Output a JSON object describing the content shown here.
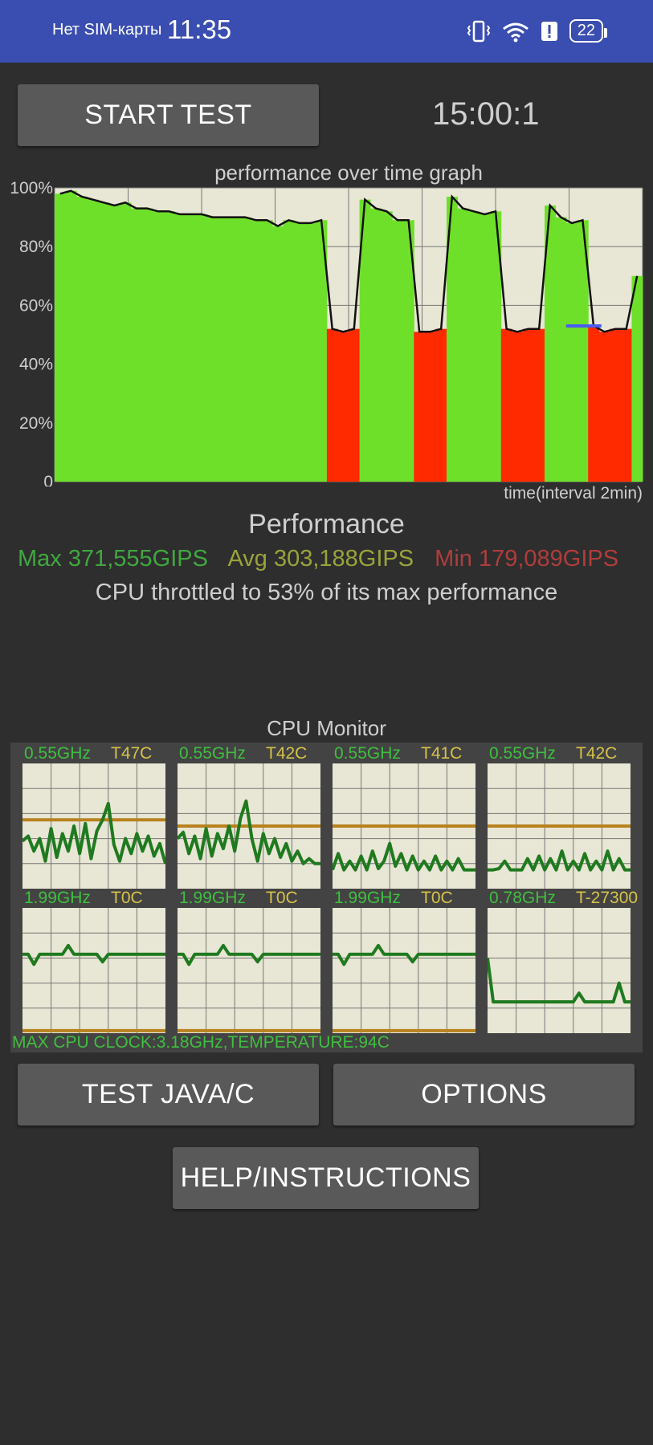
{
  "status_bar": {
    "carrier": "Нет SIM-карты",
    "time": "11:35",
    "battery": "22",
    "icons": [
      "vibrate-icon",
      "wifi-icon",
      "alert-icon",
      "battery-icon"
    ]
  },
  "buttons": {
    "start_test": "START TEST",
    "test_java_c": "TEST JAVA/C",
    "options": "OPTIONS",
    "help": "HELP/INSTRUCTIONS"
  },
  "timer": "15:00:1",
  "chart_data": {
    "type": "area",
    "title": "performance over time graph",
    "xlabel": "time(interval 2min)",
    "ylabel": "",
    "ylim": [
      0,
      100
    ],
    "y_ticks": [
      "0",
      "20%",
      "40%",
      "60%",
      "80%",
      "100%"
    ],
    "x": [
      0,
      0.5,
      1,
      1.5,
      2,
      2.5,
      3,
      3.5,
      4,
      4.5,
      5,
      5.5,
      6,
      6.5,
      7,
      7.5,
      8,
      8.5,
      9,
      9.5,
      10,
      10.5,
      11,
      11.5,
      12,
      12.5,
      13,
      13.5,
      14,
      14.5,
      15,
      15.5,
      16,
      16.5,
      17,
      17.5,
      18,
      18.5,
      19,
      19.5,
      20,
      20.5,
      21,
      21.5,
      22,
      22.5,
      23,
      23.5,
      24,
      24.5,
      25,
      25.5,
      26,
      26.5,
      27,
      27.5,
      28,
      28.5,
      29,
      29.5,
      30
    ],
    "series": [
      {
        "values": [
          98,
          99,
          97,
          96,
          95,
          94,
          95,
          93,
          93,
          92,
          92,
          91,
          91,
          91,
          90,
          90,
          90,
          90,
          89,
          89,
          87,
          89,
          88,
          88,
          89,
          52,
          51,
          52,
          96,
          93,
          92,
          89,
          89,
          51,
          51,
          52,
          97,
          93,
          92,
          91,
          92,
          52,
          51,
          52,
          52,
          94,
          90,
          88,
          89,
          53,
          51,
          52,
          52,
          70
        ]
      }
    ],
    "grid": true,
    "throttle_line": 53
  },
  "performance": {
    "title": "Performance",
    "max": "Max 371,555GIPS",
    "avg": "Avg 303,188GIPS",
    "min": "Min 179,089GIPS",
    "throttle_text": "CPU throttled to 53% of its max performance"
  },
  "cpu_monitor": {
    "title": "CPU Monitor",
    "cores": [
      {
        "freq": "0.55GHz",
        "temp": "T47C",
        "clock_level": 0.45,
        "temp_level": 0.55,
        "line": [
          0.38,
          0.42,
          0.3,
          0.4,
          0.22,
          0.48,
          0.25,
          0.44,
          0.3,
          0.5,
          0.28,
          0.52,
          0.24,
          0.46,
          0.55,
          0.68,
          0.35,
          0.22,
          0.4,
          0.28,
          0.44,
          0.3,
          0.42,
          0.26,
          0.36,
          0.2
        ]
      },
      {
        "freq": "0.55GHz",
        "temp": "T42C",
        "clock_level": 0.45,
        "temp_level": 0.5,
        "line": [
          0.4,
          0.45,
          0.28,
          0.42,
          0.24,
          0.48,
          0.26,
          0.44,
          0.32,
          0.5,
          0.3,
          0.56,
          0.7,
          0.4,
          0.22,
          0.44,
          0.28,
          0.4,
          0.25,
          0.36,
          0.22,
          0.3,
          0.2,
          0.24,
          0.2,
          0.2
        ]
      },
      {
        "freq": "0.55GHz",
        "temp": "T41C",
        "clock_level": 0.45,
        "temp_level": 0.5,
        "line": [
          0.15,
          0.28,
          0.15,
          0.22,
          0.15,
          0.26,
          0.15,
          0.3,
          0.16,
          0.22,
          0.36,
          0.18,
          0.28,
          0.15,
          0.26,
          0.15,
          0.22,
          0.15,
          0.26,
          0.15,
          0.22,
          0.15,
          0.24,
          0.15,
          0.15,
          0.15
        ]
      },
      {
        "freq": "0.55GHz",
        "temp": "T42C",
        "clock_level": 0.45,
        "temp_level": 0.5,
        "line": [
          0.15,
          0.15,
          0.16,
          0.22,
          0.15,
          0.15,
          0.15,
          0.24,
          0.15,
          0.26,
          0.15,
          0.24,
          0.15,
          0.3,
          0.15,
          0.22,
          0.15,
          0.28,
          0.15,
          0.22,
          0.15,
          0.3,
          0.15,
          0.24,
          0.15,
          0.15
        ]
      },
      {
        "freq": "1.99GHz",
        "temp": "T0C",
        "clock_level": 0.63,
        "temp_level": 0.02,
        "line": [
          0.63,
          0.63,
          0.55,
          0.63,
          0.63,
          0.63,
          0.63,
          0.63,
          0.7,
          0.63,
          0.63,
          0.63,
          0.63,
          0.63,
          0.57,
          0.63,
          0.63,
          0.63,
          0.63,
          0.63,
          0.63,
          0.63,
          0.63,
          0.63,
          0.63,
          0.63
        ]
      },
      {
        "freq": "1.99GHz",
        "temp": "T0C",
        "clock_level": 0.63,
        "temp_level": 0.02,
        "line": [
          0.63,
          0.63,
          0.55,
          0.63,
          0.63,
          0.63,
          0.63,
          0.63,
          0.7,
          0.63,
          0.63,
          0.63,
          0.63,
          0.63,
          0.57,
          0.63,
          0.63,
          0.63,
          0.63,
          0.63,
          0.63,
          0.63,
          0.63,
          0.63,
          0.63,
          0.63
        ]
      },
      {
        "freq": "1.99GHz",
        "temp": "T0C",
        "clock_level": 0.63,
        "temp_level": 0.02,
        "line": [
          0.63,
          0.63,
          0.55,
          0.63,
          0.63,
          0.63,
          0.63,
          0.63,
          0.7,
          0.63,
          0.63,
          0.63,
          0.63,
          0.63,
          0.57,
          0.63,
          0.63,
          0.63,
          0.63,
          0.63,
          0.63,
          0.63,
          0.63,
          0.63,
          0.63,
          0.63
        ]
      },
      {
        "freq": "0.78GHz",
        "temp": "T-27300",
        "clock_level": 0.25,
        "temp_level": null,
        "line": [
          0.6,
          0.25,
          0.25,
          0.25,
          0.25,
          0.25,
          0.25,
          0.25,
          0.25,
          0.25,
          0.25,
          0.25,
          0.25,
          0.25,
          0.25,
          0.25,
          0.32,
          0.25,
          0.25,
          0.25,
          0.25,
          0.25,
          0.25,
          0.4,
          0.25,
          0.25
        ]
      }
    ],
    "footer": "MAX CPU CLOCK:3.18GHz,TEMPERATURE:94C"
  },
  "colors": {
    "statusbar": "#3a4db0",
    "background": "#2e2e2e",
    "button": "#595959",
    "graph_bg": "#e8e6d4",
    "grid": "#777777",
    "green": "#1f7a1f",
    "orange": "#b8821e",
    "red": "#ff2a00",
    "bright_green": "#6fe02a"
  }
}
